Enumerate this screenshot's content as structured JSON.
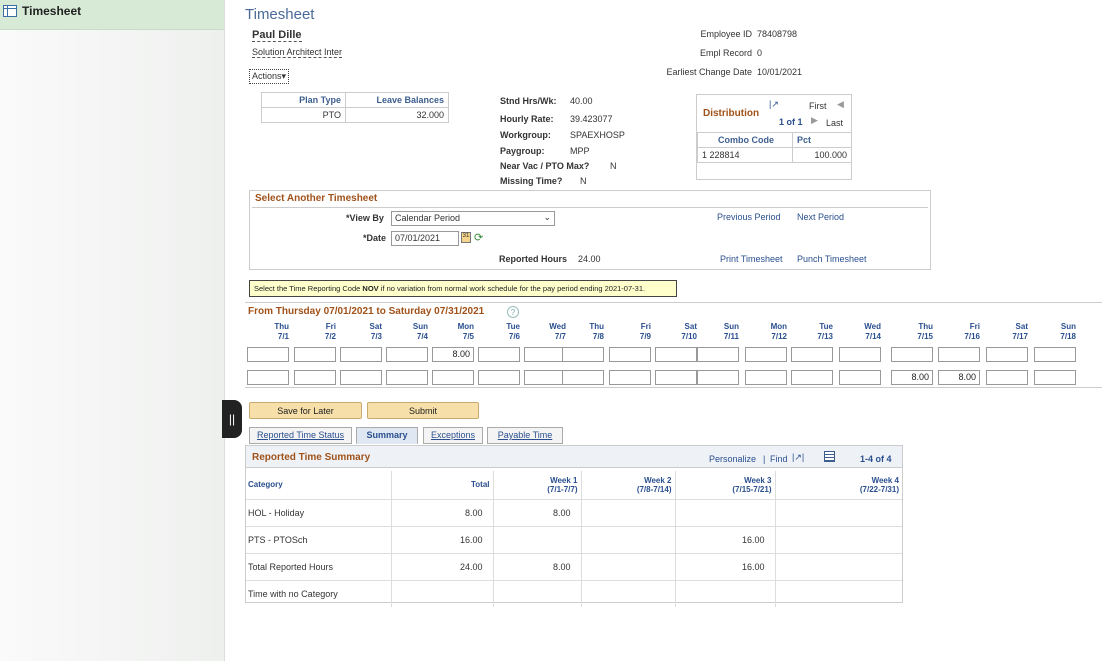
{
  "sidebar": {
    "item_label": "Timesheet"
  },
  "page": {
    "title": "Timesheet",
    "handle_glyph": "||"
  },
  "employee": {
    "name": "Paul Dille",
    "job_title": "Solution Architect Inter",
    "actions_label": "Actions",
    "employee_id_label": "Employee ID",
    "employee_id": "78408798",
    "empl_record_label": "Empl Record",
    "empl_record": "0",
    "earliest_change_label": "Earliest Change Date",
    "earliest_change": "10/01/2021"
  },
  "leave": {
    "headers": [
      "Plan Type",
      "Leave Balances"
    ],
    "rows": [
      {
        "plan": "PTO",
        "balance": "32.000"
      }
    ]
  },
  "details": [
    {
      "label": "Stnd Hrs/Wk:",
      "value": "40.00"
    },
    {
      "label": "Hourly Rate:",
      "value": "39.423077"
    },
    {
      "label": "Workgroup:",
      "value": "SPAEXHOSP"
    },
    {
      "label": "Paygroup:",
      "value": "MPP"
    },
    {
      "label": "Near Vac / PTO Max?",
      "value": "N"
    },
    {
      "label": "Missing Time?",
      "value": "N"
    }
  ],
  "distribution": {
    "title": "Distribution",
    "first": "First",
    "last": "Last",
    "pager": "1 of 1",
    "headers": [
      "Combo Code",
      "Pct"
    ],
    "rows": [
      {
        "num": "1",
        "code": "228814",
        "pct": "100.000"
      }
    ]
  },
  "select": {
    "title": "Select Another Timesheet",
    "view_by_label": "*View By",
    "view_by_value": "Calendar Period",
    "date_label": "*Date",
    "date_value": "07/01/2021",
    "previous_period": "Previous Period",
    "next_period": "Next Period",
    "reported_hours_label": "Reported Hours",
    "reported_hours": "24.00",
    "print_timesheet": "Print Timesheet",
    "punch_timesheet": "Punch Timesheet"
  },
  "notice": {
    "prefix": "Select the Time Reporting Code ",
    "code": "NOV",
    "suffix": " if no variation from normal work schedule for the pay period ending 2021-07-31."
  },
  "grid": {
    "range_title": "From Thursday 07/01/2021 to Saturday 07/31/2021",
    "help": "?",
    "days": [
      {
        "dow": "Thu",
        "date": "7/1"
      },
      {
        "dow": "Fri",
        "date": "7/2"
      },
      {
        "dow": "Sat",
        "date": "7/3"
      },
      {
        "dow": "Sun",
        "date": "7/4"
      },
      {
        "dow": "Mon",
        "date": "7/5"
      },
      {
        "dow": "Tue",
        "date": "7/6"
      },
      {
        "dow": "Wed",
        "date": "7/7"
      },
      {
        "dow": "Thu",
        "date": "7/8"
      },
      {
        "dow": "Fri",
        "date": "7/9"
      },
      {
        "dow": "Sat",
        "date": "7/10"
      },
      {
        "dow": "Sun",
        "date": "7/11"
      },
      {
        "dow": "Mon",
        "date": "7/12"
      },
      {
        "dow": "Tue",
        "date": "7/13"
      },
      {
        "dow": "Wed",
        "date": "7/14"
      },
      {
        "dow": "Thu",
        "date": "7/15"
      },
      {
        "dow": "Fri",
        "date": "7/16"
      },
      {
        "dow": "Sat",
        "date": "7/17"
      },
      {
        "dow": "Sun",
        "date": "7/18"
      }
    ],
    "row1": [
      "",
      "",
      "",
      "",
      "8.00",
      "",
      "",
      "",
      "",
      "",
      "",
      "",
      "",
      "",
      "",
      "",
      "",
      ""
    ],
    "row2": [
      "",
      "",
      "",
      "",
      "",
      "",
      "",
      "",
      "",
      "",
      "",
      "",
      "",
      "",
      "8.00",
      "8.00",
      "",
      ""
    ]
  },
  "buttons": {
    "save_for_later": "Save for Later",
    "submit": "Submit"
  },
  "tabs": [
    "Reported Time Status",
    "Summary",
    "Exceptions",
    "Payable Time"
  ],
  "summary": {
    "title": "Reported Time Summary",
    "personalize": "Personalize",
    "find": "Find",
    "pager": "1-4 of 4",
    "headers": [
      "Category",
      "Total",
      "Week 1\n(7/1-7/7)",
      "Week 2\n(7/8-7/14)",
      "Week 3\n(7/15-7/21)",
      "Week 4\n(7/22-7/31)"
    ],
    "rows": [
      [
        "HOL - Holiday",
        "8.00",
        "8.00",
        "",
        "",
        ""
      ],
      [
        "PTS - PTOSch",
        "16.00",
        "",
        "",
        "16.00",
        ""
      ],
      [
        "Total Reported Hours",
        "24.00",
        "8.00",
        "",
        "16.00",
        ""
      ],
      [
        "Time with no Category",
        "",
        "",
        "",
        "",
        ""
      ]
    ]
  }
}
